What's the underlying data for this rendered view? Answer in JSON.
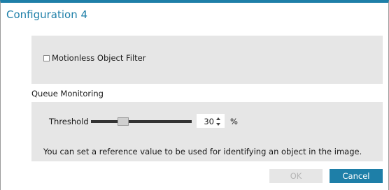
{
  "dialog": {
    "title": "Configuration 4"
  },
  "motionless_filter": {
    "label": "Motionless Object Filter",
    "checked": false
  },
  "queue_monitoring": {
    "section_label": "Queue Monitoring",
    "threshold_label": "Threshold",
    "threshold_value": "30",
    "threshold_fraction": 0.3,
    "unit": "%",
    "hint": "You can set a reference value to be used for identifying an object in the image."
  },
  "buttons": {
    "ok_label": "OK",
    "cancel_label": "Cancel"
  },
  "colors": {
    "accent": "#1e7fa8",
    "panel": "#e6e6e6",
    "disabled_text": "#b5b5b5"
  }
}
